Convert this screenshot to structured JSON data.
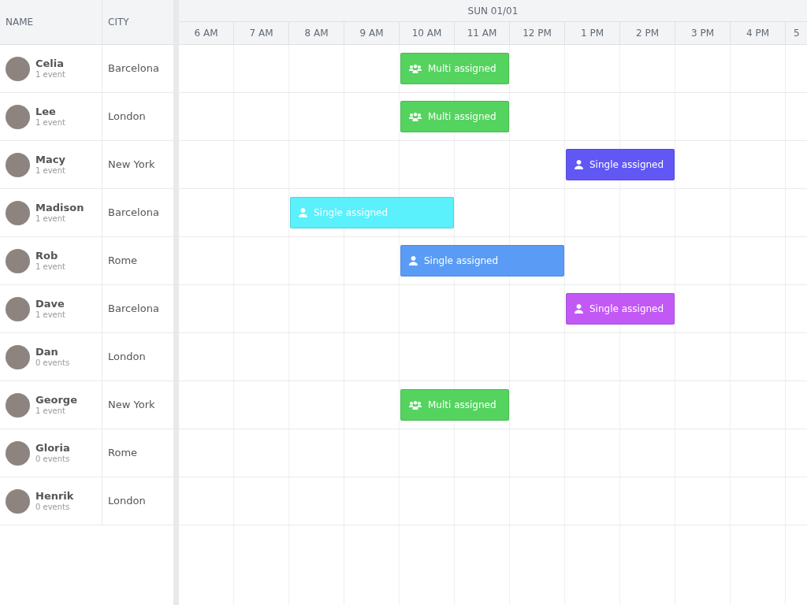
{
  "columns": [
    {
      "label": "NAME"
    },
    {
      "label": "CITY"
    }
  ],
  "date": "SUN 01/01",
  "hours": [
    "6 AM",
    "7 AM",
    "8 AM",
    "9 AM",
    "10 AM",
    "11 AM",
    "12 PM",
    "1 PM",
    "2 PM",
    "3 PM",
    "4 PM",
    "5"
  ],
  "resources": [
    {
      "name": "Celia",
      "events_count": "1 event",
      "city": "Barcelona",
      "events": [
        {
          "label": "Multi assigned",
          "kind": "multi",
          "color": "#54d35f"
        }
      ]
    },
    {
      "name": "Lee",
      "events_count": "1 event",
      "city": "London",
      "events": [
        {
          "label": "Multi assigned",
          "kind": "multi",
          "color": "#54d35f"
        }
      ]
    },
    {
      "name": "Macy",
      "events_count": "1 event",
      "city": "New York",
      "events": [
        {
          "label": "Single assigned",
          "kind": "single",
          "color": "#6157f5"
        }
      ]
    },
    {
      "name": "Madison",
      "events_count": "1 event",
      "city": "Barcelona",
      "events": [
        {
          "label": "Single assigned",
          "kind": "single",
          "color": "#5af0fc"
        }
      ]
    },
    {
      "name": "Rob",
      "events_count": "1 event",
      "city": "Rome",
      "events": [
        {
          "label": "Single assigned",
          "kind": "single",
          "color": "#5a9cf5"
        }
      ]
    },
    {
      "name": "Dave",
      "events_count": "1 event",
      "city": "Barcelona",
      "events": [
        {
          "label": "Single assigned",
          "kind": "single",
          "color": "#c259f5"
        }
      ]
    },
    {
      "name": "Dan",
      "events_count": "0 events",
      "city": "London"
    },
    {
      "name": "George",
      "events_count": "1 event",
      "city": "New York",
      "events": [
        {
          "label": "Multi assigned",
          "kind": "multi",
          "color": "#54d35f"
        }
      ]
    },
    {
      "name": "Gloria",
      "events_count": "0 events",
      "city": "Rome"
    },
    {
      "name": "Henrik",
      "events_count": "0 events",
      "city": "London"
    }
  ]
}
